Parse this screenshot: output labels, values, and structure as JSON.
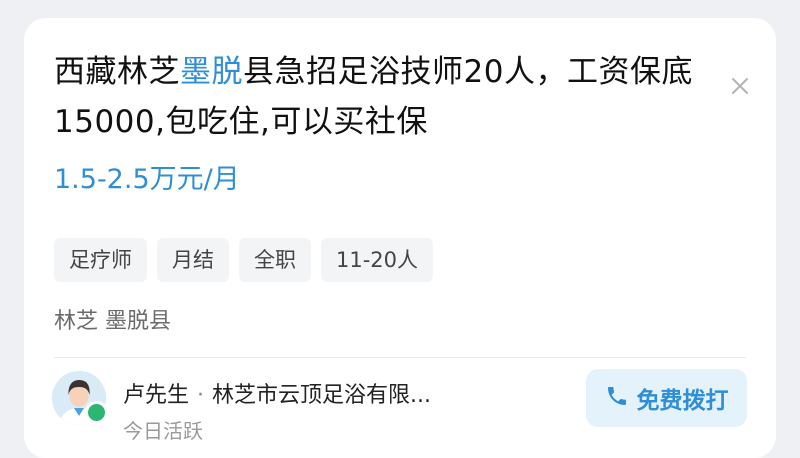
{
  "job": {
    "title_prefix": "西藏林芝",
    "title_highlight": "墨脱",
    "title_suffix": "县急招足浴技师20人，工资保底15000,包吃住,可以买社保",
    "salary": "1.5-2.5万元/月",
    "tags": [
      "足疗师",
      "月结",
      "全职",
      "11-20人"
    ],
    "location": "林芝 墨脱县"
  },
  "contact": {
    "name": "卢先生",
    "separator": "·",
    "company": "林芝市云顶足浴有限...",
    "activity": "今日活跃",
    "call_button_label": "免费拨打"
  },
  "colors": {
    "accent": "#2f8fd6",
    "online": "#2bb673",
    "call_button_bg": "#e4f2fb"
  },
  "icons": {
    "close": "close-icon",
    "phone": "phone-icon",
    "avatar": "person-avatar"
  }
}
